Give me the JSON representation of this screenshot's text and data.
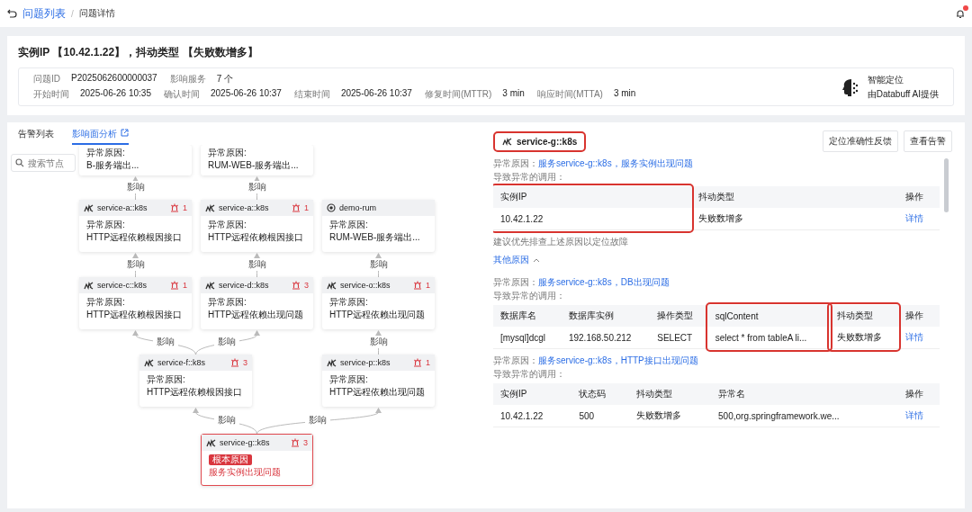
{
  "topbar": {
    "back_link": "问题列表",
    "separator": "/",
    "current": "问题详情"
  },
  "summary": {
    "title": "实例IP 【10.42.1.22】，抖动类型 【失败数增多】",
    "rows": [
      [
        {
          "label": "问题ID",
          "value": "P2025062600000037"
        },
        {
          "label": "影响服务",
          "value": "7 个"
        }
      ],
      [
        {
          "label": "开始时间",
          "value": "2025-06-26 10:35"
        },
        {
          "label": "确认时间",
          "value": "2025-06-26 10:37"
        },
        {
          "label": "结束时间",
          "value": "2025-06-26 10:37"
        },
        {
          "label": "修复时间(MTTR)",
          "value": "3 min"
        },
        {
          "label": "响应时间(MTTA)",
          "value": "3 min"
        }
      ]
    ],
    "ai": {
      "title": "智能定位",
      "subtitle": "由Databuff AI提供"
    }
  },
  "tabs": [
    {
      "label": "告警列表",
      "selected": false
    },
    {
      "label": "影响面分析",
      "selected": true,
      "link_icon": true
    }
  ],
  "graph": {
    "search": {
      "placeholder": "搜索节点"
    },
    "nodes": [
      {
        "kind": "partial",
        "cause_label": "异常原因:",
        "cause": "B-服务端出..."
      },
      {
        "kind": "partial",
        "cause_label": "异常原因:",
        "cause": "RUM-WEB-服务端出..."
      },
      {
        "kind": "service",
        "name": "service-a::k8s",
        "alarms": "1",
        "cause_label": "异常原因:",
        "cause": "HTTP远程依赖根因接口"
      },
      {
        "kind": "service",
        "name": "service-a::k8s",
        "alarms": "1",
        "cause_label": "异常原因:",
        "cause": "HTTP远程依赖根因接口"
      },
      {
        "kind": "rum",
        "name": "demo-rum",
        "cause_label": "异常原因:",
        "cause": "RUM-WEB-服务端出..."
      },
      {
        "kind": "service",
        "name": "service-c::k8s",
        "alarms": "1",
        "cause_label": "异常原因:",
        "cause": "HTTP远程依赖根因接口"
      },
      {
        "kind": "service",
        "name": "service-d::k8s",
        "alarms": "3",
        "cause_label": "异常原因:",
        "cause": "HTTP远程依赖出现问题"
      },
      {
        "kind": "service",
        "name": "service-o::k8s",
        "alarms": "1",
        "cause_label": "异常原因:",
        "cause": "HTTP远程依赖出现问题"
      },
      {
        "kind": "service",
        "name": "service-f::k8s",
        "alarms": "3",
        "cause_label": "异常原因:",
        "cause": "HTTP远程依赖根因接口"
      },
      {
        "kind": "service",
        "name": "service-p::k8s",
        "alarms": "1",
        "cause_label": "异常原因:",
        "cause": "HTTP远程依赖出现问题"
      },
      {
        "kind": "root",
        "name": "service-g::k8s",
        "alarms": "3",
        "tag": "根本原因",
        "cause": "服务实例出现问题"
      }
    ],
    "edges": [
      {
        "label": "影响"
      },
      {
        "label": "影响"
      },
      {
        "label": "影响"
      },
      {
        "label": "影响"
      },
      {
        "label": "影响"
      },
      {
        "label": "影响"
      },
      {
        "label": "影响"
      },
      {
        "label": "影响"
      },
      {
        "label": "影响"
      },
      {
        "label": "影响"
      }
    ]
  },
  "detail": {
    "title": "service-g::k8s",
    "highlighted": true,
    "buttons": [
      "定位准确性反馈",
      "查看告警"
    ],
    "primary": {
      "cause_label": "异常原因：",
      "cause": "服务service-g::k8s，服务实例出现问题",
      "calls_label": "导致异常的调用：",
      "columns": [
        {
          "label": "实例IP",
          "kind": "text",
          "highlighted": true
        },
        {
          "label": "抖动类型",
          "kind": "text",
          "highlighted": false
        },
        {
          "label": "操作",
          "kind": "action",
          "highlighted": false
        }
      ],
      "rows": [
        [
          "10.42.1.22",
          "失败数增多",
          "详情"
        ]
      ]
    },
    "hint": "建议优先排查上述原因以定位故障",
    "more": {
      "label": "其他原因",
      "expanded": true
    },
    "others": [
      {
        "cause_label": "异常原因：",
        "cause": "服务service-g::k8s，DB出现问题",
        "calls_label": "导致异常的调用：",
        "columns": [
          {
            "label": "数据库名",
            "kind": "text",
            "highlighted": false
          },
          {
            "label": "数据库实例",
            "kind": "text",
            "highlighted": false
          },
          {
            "label": "操作类型",
            "kind": "text",
            "highlighted": false
          },
          {
            "label": "sqlContent",
            "kind": "text",
            "highlighted": true
          },
          {
            "label": "抖动类型",
            "kind": "text",
            "highlighted": true
          },
          {
            "label": "操作",
            "kind": "action",
            "highlighted": false
          }
        ],
        "rows": [
          [
            "[mysql]dcgl",
            "192.168.50.212",
            "SELECT",
            "select * from tableA li...",
            "失败数增多",
            "详情"
          ]
        ]
      },
      {
        "cause_label": "异常原因：",
        "cause": "服务service-g::k8s，HTTP接口出现问题",
        "calls_label": "导致异常的调用：",
        "columns": [
          {
            "label": "实例IP",
            "kind": "text",
            "highlighted": false
          },
          {
            "label": "状态码",
            "kind": "text",
            "highlighted": false
          },
          {
            "label": "抖动类型",
            "kind": "text",
            "highlighted": false
          },
          {
            "label": "异常名",
            "kind": "text",
            "highlighted": false
          },
          {
            "label": "操作",
            "kind": "action",
            "highlighted": false
          }
        ],
        "rows": [
          [
            "10.42.1.22",
            "500",
            "失败数增多",
            "500,org.springframework.we...",
            "详情"
          ]
        ]
      }
    ]
  }
}
